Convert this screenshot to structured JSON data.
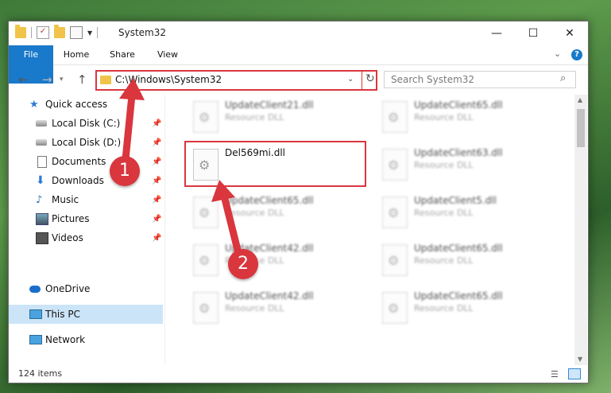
{
  "window": {
    "title": "System32"
  },
  "ribbon": {
    "file": "File",
    "home": "Home",
    "share": "Share",
    "view": "View",
    "help_glyph": "?"
  },
  "address": {
    "path": "C:\\Windows\\System32"
  },
  "search": {
    "placeholder": "Search System32"
  },
  "nav_pane": {
    "quick_access": "Quick access",
    "local_c": "Local Disk (C:)",
    "local_d": "Local Disk (D:)",
    "documents": "Documents",
    "downloads": "Downloads",
    "music": "Music",
    "pictures": "Pictures",
    "videos": "Videos",
    "onedrive": "OneDrive",
    "this_pc": "This PC",
    "network": "Network"
  },
  "files": {
    "c1r1": {
      "name": "UpdateClient21.dll",
      "type": "Resource DLL"
    },
    "c2r1": {
      "name": "UpdateClient65.dll",
      "type": "Resource DLL"
    },
    "highlighted": {
      "name": "Del569mi.dll"
    },
    "c2r2": {
      "name": "UpdateClient63.dll",
      "type": "Resource DLL"
    },
    "c1r3": {
      "name": "UpdateClient65.dll",
      "type": "Resource DLL"
    },
    "c2r3": {
      "name": "UpdateClient5.dll",
      "type": "Resource DLL"
    },
    "c1r4": {
      "name": "UpdateClient42.dll",
      "type": "Resource DLL"
    },
    "c2r4": {
      "name": "UpdateClient65.dll",
      "type": "Resource DLL"
    },
    "c1r5": {
      "name": "UpdateClient42.dll",
      "type": "Resource DLL"
    },
    "c2r5": {
      "name": "UpdateClient65.dll",
      "type": "Resource DLL"
    }
  },
  "status": {
    "count": "124 items"
  },
  "annotations": {
    "step1": "1",
    "step2": "2",
    "color": "#d9363e"
  }
}
